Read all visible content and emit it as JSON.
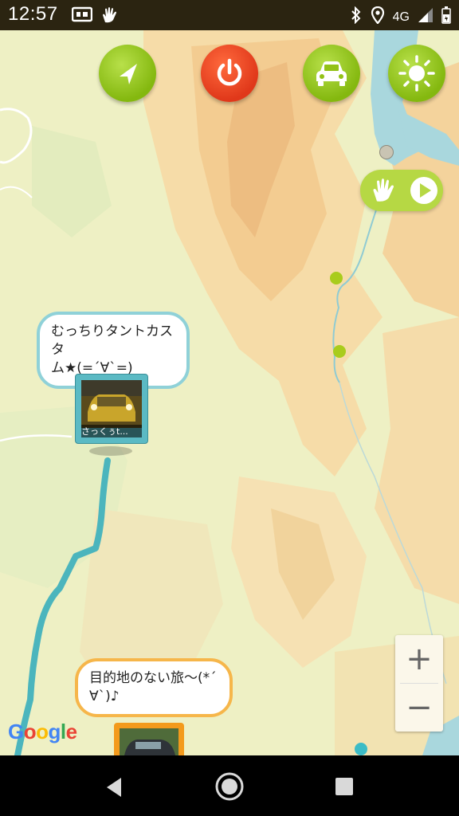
{
  "status_bar": {
    "time": "12:57",
    "network": "4G",
    "icons": [
      "screen-record-icon",
      "hand-icon",
      "bluetooth-icon",
      "location-icon",
      "signal-icon",
      "battery-icon"
    ]
  },
  "map_controls": {
    "icons": [
      "navigation-arrow-icon",
      "power-icon",
      "car-icon",
      "sun-icon",
      "hand-icon",
      "play-icon"
    ]
  },
  "markers": [
    {
      "bubble_text_line1": "むっちりタントカスタ",
      "bubble_text_line2": "ム★(=´∀`=)",
      "thumb_caption": "さっくぅt...",
      "color": "#5bbac4"
    },
    {
      "bubble_text_line1": "目的地のない旅〜(*´",
      "bubble_text_line2": "∀`)♪",
      "color": "#f39a1c"
    }
  ],
  "zoom": {
    "in_label": "+",
    "out_label": "−"
  },
  "map_attribution": {
    "g1": "G",
    "o1": "o",
    "o2": "o",
    "g2": "g",
    "l": "l",
    "e": "e"
  },
  "colors": {
    "route": "#4bb5bd",
    "accent_green": "#9ccb21",
    "power_red": "#e43b1e"
  }
}
